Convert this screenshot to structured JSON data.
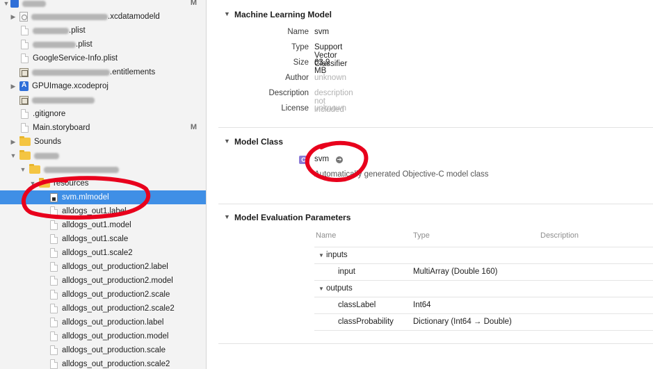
{
  "navigator": {
    "items": [
      {
        "label": ".xcdatamodeld",
        "blurred_prefix": true
      },
      {
        "label": ".plist",
        "blurred_prefix": true
      },
      {
        "label": ".plist",
        "blurred_prefix": true
      },
      {
        "label": "GoogleService-Info.plist"
      },
      {
        "label": ".entitlements",
        "blurred_prefix": true
      },
      {
        "label": "GPUImage.xcodeproj"
      },
      {
        "label": ""
      },
      {
        "label": ".gitignore"
      },
      {
        "label": "Main.storyboard",
        "badge": "M"
      },
      {
        "label": "Sounds"
      },
      {
        "label": ""
      },
      {
        "label": ""
      },
      {
        "label": "resources"
      },
      {
        "label": "svm.mlmodel"
      },
      {
        "label": "alldogs_out1.label"
      },
      {
        "label": "alldogs_out1.model"
      },
      {
        "label": "alldogs_out1.scale"
      },
      {
        "label": "alldogs_out1.scale2"
      },
      {
        "label": "alldogs_out_production2.label"
      },
      {
        "label": "alldogs_out_production2.model"
      },
      {
        "label": "alldogs_out_production2.scale"
      },
      {
        "label": "alldogs_out_production2.scale2"
      },
      {
        "label": "alldogs_out_production.label"
      },
      {
        "label": "alldogs_out_production.model"
      },
      {
        "label": "alldogs_out_production.scale"
      },
      {
        "label": "alldogs_out_production.scale2"
      }
    ],
    "top_badge": "M"
  },
  "ml_model": {
    "title": "Machine Learning Model",
    "fields": [
      {
        "key": "Name",
        "value": "svm",
        "dim": false
      },
      {
        "key": "Type",
        "value": "Support Vector Classifier",
        "dim": false
      },
      {
        "key": "Size",
        "value": "63,9 MB",
        "dim": false
      },
      {
        "key": "Author",
        "value": "unknown",
        "dim": true
      },
      {
        "key": "Description",
        "value": "description not included",
        "dim": true
      },
      {
        "key": "License",
        "value": "unknown",
        "dim": true
      }
    ]
  },
  "model_class": {
    "title": "Model Class",
    "badge": "C",
    "name": "svm",
    "description": "Automatically generated Objective-C model class"
  },
  "evaluation": {
    "title": "Model Evaluation Parameters",
    "headers": {
      "name": "Name",
      "type": "Type",
      "description": "Description"
    },
    "groups": [
      {
        "label": "inputs",
        "rows": [
          {
            "name": "input",
            "type": "MultiArray (Double 160)"
          }
        ]
      },
      {
        "label": "outputs",
        "rows": [
          {
            "name": "classLabel",
            "type": "Int64"
          },
          {
            "name": "classProbability",
            "type": "Dictionary (Int64 → Double)"
          }
        ]
      }
    ]
  },
  "colors": {
    "selection": "#3f8fe6",
    "annotation": "#e8001c"
  },
  "icons": {
    "collapse": "disclosure-triangle-icon",
    "go": "go-arrow-icon"
  }
}
